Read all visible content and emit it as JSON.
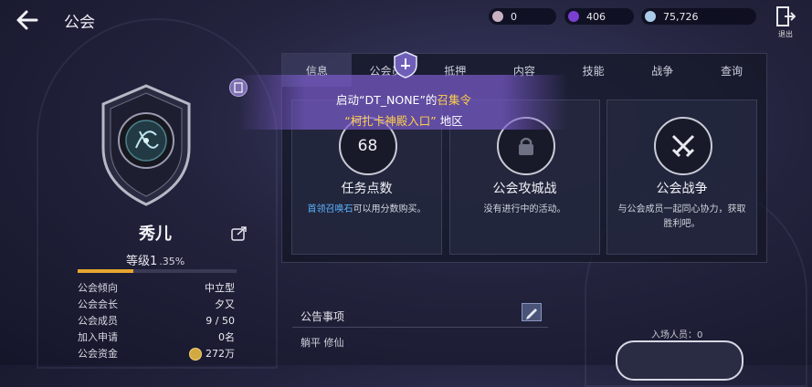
{
  "header": {
    "title": "公会",
    "currencies": [
      {
        "value": "0",
        "icon": "pearl-icon",
        "color": "#c9b0c2"
      },
      {
        "value": "406",
        "icon": "purple-gem-icon",
        "color": "#7a3fd1"
      },
      {
        "value": "75,726",
        "icon": "silver-gem-icon",
        "color": "#a9cbe8"
      }
    ],
    "exit_label": "退出"
  },
  "guild": {
    "name": "秀儿",
    "level_text": "等级1",
    "level_pct": ".35%",
    "exp_fraction": 0.35,
    "info": [
      {
        "label": "公会倾向",
        "value": "中立型"
      },
      {
        "label": "公会会长",
        "value": "夕又"
      },
      {
        "label": "公会成员",
        "value": "9 / 50"
      },
      {
        "label": "加入申请",
        "value": "0名"
      },
      {
        "label": "公会资金",
        "value": "272万"
      }
    ]
  },
  "tabs": [
    "信息",
    "公会员",
    "抵押",
    "内容",
    "技能",
    "战争",
    "查询"
  ],
  "banner": {
    "line1_pre": "启动“DT_NONE”的",
    "line1_em": "召集令",
    "line2_em": "“柯扎卡神殿入口”",
    "line2_post": " 地区"
  },
  "cards": [
    {
      "icon_text": "68",
      "title": "任务点数",
      "desc_hl": "首领召唤石",
      "desc": "可以用分数购买。"
    },
    {
      "icon_text": "",
      "title": "公会攻城战",
      "desc_hl": "",
      "desc": "没有进行中的活动。"
    },
    {
      "icon_text": "",
      "title": "公会战争",
      "desc_hl": "",
      "desc": "与公会成员一起同心协力，获取胜利吧。"
    }
  ],
  "notice": {
    "title": "公告事项",
    "text": "躺平 修仙"
  },
  "entry": {
    "count_label": "入场人员：0"
  }
}
